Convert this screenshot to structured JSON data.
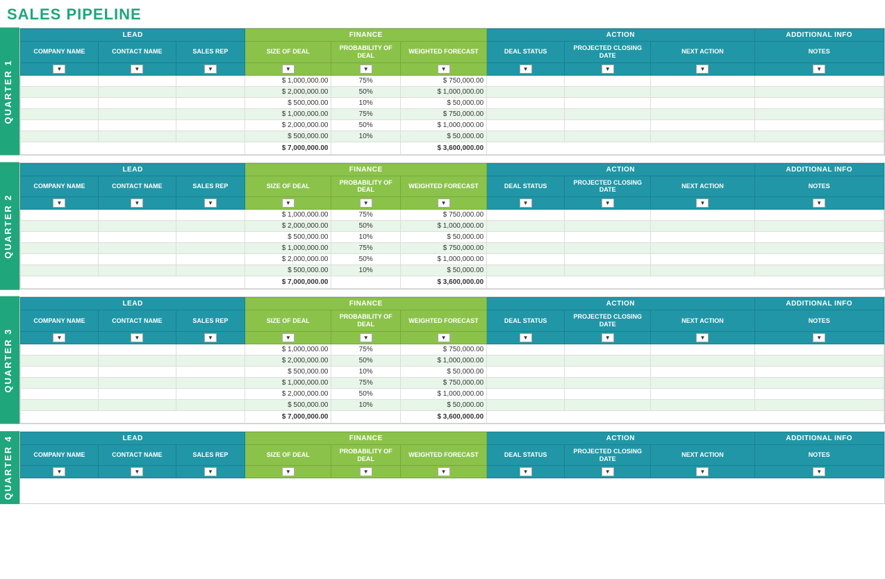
{
  "title": "SALES PIPELINE",
  "group_headers": {
    "lead": "LEAD",
    "finance": "FINANCE",
    "action": "ACTION",
    "additional_info": "ADDITIONAL INFO"
  },
  "col_headers": {
    "company_name": "COMPANY NAME",
    "contact_name": "CONTACT NAME",
    "sales_rep": "SALES REP",
    "size_of_deal": "SIZE OF DEAL",
    "probability_of_deal": "PROBABILITY OF DEAL",
    "weighted_forecast": "WEIGHTED FORECAST",
    "deal_status": "DEAL STATUS",
    "projected_closing_date": "PROJECTED CLOSING DATE",
    "next_action": "NEXT ACTION",
    "notes": "NOTES"
  },
  "quarters": [
    {
      "label": "QUARTER 1",
      "rows": [
        {
          "company": "",
          "contact": "",
          "salesrep": "",
          "deal_size": "$ 1,000,000.00",
          "prob": "75%",
          "weighted": "$ 750,000.00",
          "status": "",
          "proj_close": "",
          "next_action": "",
          "notes": "",
          "alt": false
        },
        {
          "company": "",
          "contact": "",
          "salesrep": "",
          "deal_size": "$ 2,000,000.00",
          "prob": "50%",
          "weighted": "$ 1,000,000.00",
          "status": "",
          "proj_close": "",
          "next_action": "",
          "notes": "",
          "alt": true
        },
        {
          "company": "",
          "contact": "",
          "salesrep": "",
          "deal_size": "$ 500,000.00",
          "prob": "10%",
          "weighted": "$ 50,000.00",
          "status": "",
          "proj_close": "",
          "next_action": "",
          "notes": "",
          "alt": false
        },
        {
          "company": "",
          "contact": "",
          "salesrep": "",
          "deal_size": "$ 1,000,000.00",
          "prob": "75%",
          "weighted": "$ 750,000.00",
          "status": "",
          "proj_close": "",
          "next_action": "",
          "notes": "",
          "alt": true
        },
        {
          "company": "",
          "contact": "",
          "salesrep": "",
          "deal_size": "$ 2,000,000.00",
          "prob": "50%",
          "weighted": "$ 1,000,000.00",
          "status": "",
          "proj_close": "",
          "next_action": "",
          "notes": "",
          "alt": false
        },
        {
          "company": "",
          "contact": "",
          "salesrep": "",
          "deal_size": "$ 500,000.00",
          "prob": "10%",
          "weighted": "$ 50,000.00",
          "status": "",
          "proj_close": "",
          "next_action": "",
          "notes": "",
          "alt": true
        }
      ],
      "total_deal": "$ 7,000,000.00",
      "total_weighted": "$ 3,600,000.00"
    },
    {
      "label": "QUARTER 2",
      "rows": [
        {
          "company": "",
          "contact": "",
          "salesrep": "",
          "deal_size": "$ 1,000,000.00",
          "prob": "75%",
          "weighted": "$ 750,000.00",
          "status": "",
          "proj_close": "",
          "next_action": "",
          "notes": "",
          "alt": false
        },
        {
          "company": "",
          "contact": "",
          "salesrep": "",
          "deal_size": "$ 2,000,000.00",
          "prob": "50%",
          "weighted": "$ 1,000,000.00",
          "status": "",
          "proj_close": "",
          "next_action": "",
          "notes": "",
          "alt": true
        },
        {
          "company": "",
          "contact": "",
          "salesrep": "",
          "deal_size": "$ 500,000.00",
          "prob": "10%",
          "weighted": "$ 50,000.00",
          "status": "",
          "proj_close": "",
          "next_action": "",
          "notes": "",
          "alt": false
        },
        {
          "company": "",
          "contact": "",
          "salesrep": "",
          "deal_size": "$ 1,000,000.00",
          "prob": "75%",
          "weighted": "$ 750,000.00",
          "status": "",
          "proj_close": "",
          "next_action": "",
          "notes": "",
          "alt": true
        },
        {
          "company": "",
          "contact": "",
          "salesrep": "",
          "deal_size": "$ 2,000,000.00",
          "prob": "50%",
          "weighted": "$ 1,000,000.00",
          "status": "",
          "proj_close": "",
          "next_action": "",
          "notes": "",
          "alt": false
        },
        {
          "company": "",
          "contact": "",
          "salesrep": "",
          "deal_size": "$ 500,000.00",
          "prob": "10%",
          "weighted": "$ 50,000.00",
          "status": "",
          "proj_close": "",
          "next_action": "",
          "notes": "",
          "alt": true
        }
      ],
      "total_deal": "$ 7,000,000.00",
      "total_weighted": "$ 3,600,000.00"
    },
    {
      "label": "QUARTER 3",
      "rows": [
        {
          "company": "",
          "contact": "",
          "salesrep": "",
          "deal_size": "$ 1,000,000.00",
          "prob": "75%",
          "weighted": "$ 750,000.00",
          "status": "",
          "proj_close": "",
          "next_action": "",
          "notes": "",
          "alt": false
        },
        {
          "company": "",
          "contact": "",
          "salesrep": "",
          "deal_size": "$ 2,000,000.00",
          "prob": "50%",
          "weighted": "$ 1,000,000.00",
          "status": "",
          "proj_close": "",
          "next_action": "",
          "notes": "",
          "alt": true
        },
        {
          "company": "",
          "contact": "",
          "salesrep": "",
          "deal_size": "$ 500,000.00",
          "prob": "10%",
          "weighted": "$ 50,000.00",
          "status": "",
          "proj_close": "",
          "next_action": "",
          "notes": "",
          "alt": false
        },
        {
          "company": "",
          "contact": "",
          "salesrep": "",
          "deal_size": "$ 1,000,000.00",
          "prob": "75%",
          "weighted": "$ 750,000.00",
          "status": "",
          "proj_close": "",
          "next_action": "",
          "notes": "",
          "alt": true
        },
        {
          "company": "",
          "contact": "",
          "salesrep": "",
          "deal_size": "$ 2,000,000.00",
          "prob": "50%",
          "weighted": "$ 1,000,000.00",
          "status": "",
          "proj_close": "",
          "next_action": "",
          "notes": "",
          "alt": false
        },
        {
          "company": "",
          "contact": "",
          "salesrep": "",
          "deal_size": "$ 500,000.00",
          "prob": "10%",
          "weighted": "$ 50,000.00",
          "status": "",
          "proj_close": "",
          "next_action": "",
          "notes": "",
          "alt": true
        }
      ],
      "total_deal": "$ 7,000,000.00",
      "total_weighted": "$ 3,600,000.00"
    },
    {
      "label": "QUARTER 4",
      "rows": [],
      "total_deal": "",
      "total_weighted": ""
    }
  ]
}
